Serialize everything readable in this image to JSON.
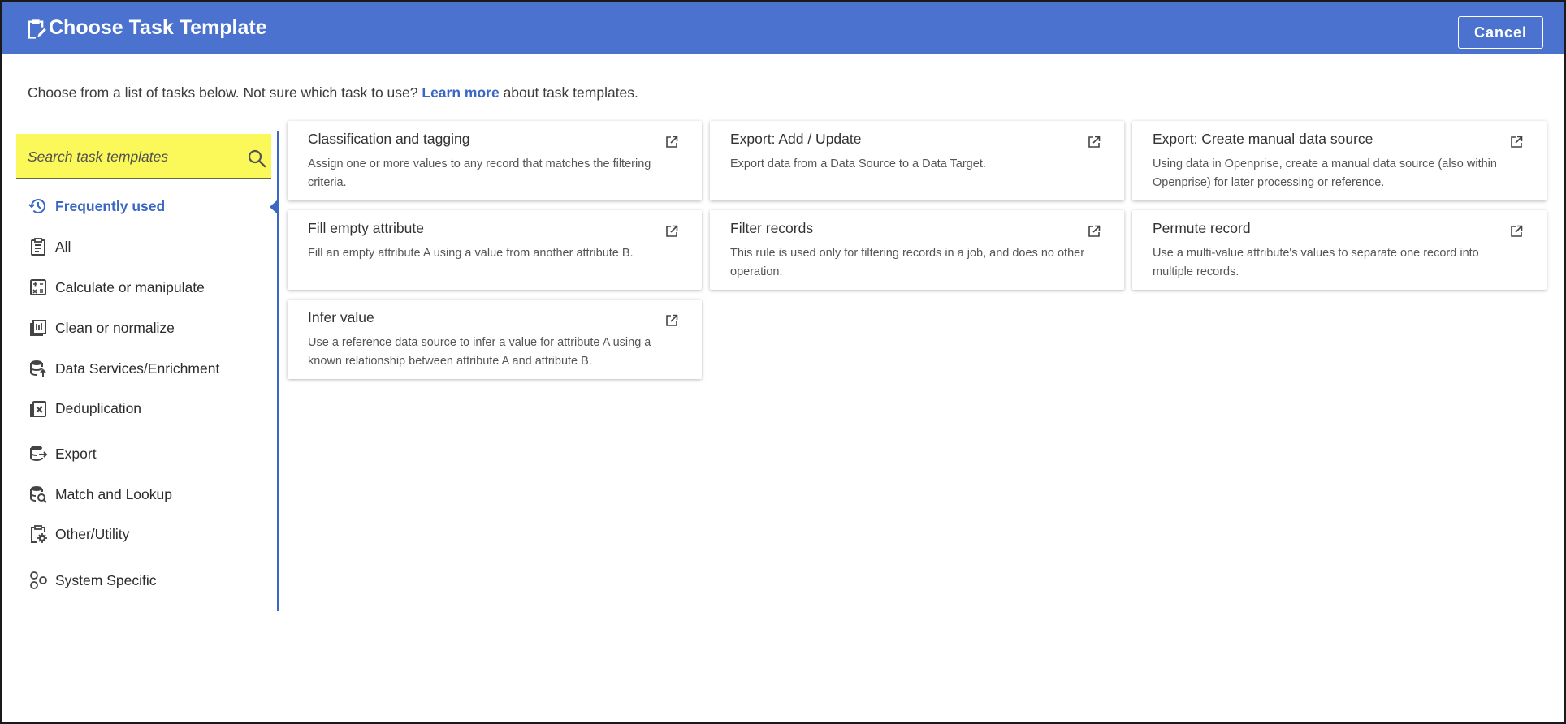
{
  "dialog": {
    "title": "Choose Task Template",
    "cancel_label": "Cancel",
    "header_color": "#4a72ce"
  },
  "intro": {
    "text_before": "Choose from a list of tasks below. Not sure which task to use?",
    "link_text": "Learn more",
    "text_after": "about task templates."
  },
  "search": {
    "placeholder": "Search task templates",
    "value": ""
  },
  "nav": {
    "items": [
      {
        "label": "Frequently used",
        "icon": "history-icon",
        "active": true
      },
      {
        "label": "All",
        "icon": "clipboard-list-icon"
      },
      {
        "label": "Calculate or manipulate",
        "icon": "calculator-icon"
      },
      {
        "label": "Clean or normalize",
        "icon": "list-broom-icon"
      },
      {
        "label": "Data Services/Enrichment",
        "icon": "database-upload-icon"
      },
      {
        "label": "Deduplication",
        "icon": "clipboard-remove-icon"
      },
      {
        "label": "Export",
        "icon": "database-export-icon"
      },
      {
        "label": "Match and Lookup",
        "icon": "database-search-icon"
      },
      {
        "label": "Other/Utility",
        "icon": "clipboard-gear-icon"
      },
      {
        "label": "System Specific",
        "icon": "shapes-icon"
      }
    ]
  },
  "cards": [
    {
      "title": "Classification and tagging",
      "desc": "Assign one or more values to any record that matches the filtering criteria."
    },
    {
      "title": "Export: Add / Update",
      "desc": "Export data from a Data Source to a Data Target."
    },
    {
      "title": "Export: Create manual data source",
      "desc": "Using data in Openprise, create a manual data source (also within Openprise) for later processing or reference."
    },
    {
      "title": "Fill empty attribute",
      "desc": "Fill an empty attribute A using a value from another attribute B."
    },
    {
      "title": "Filter records",
      "desc": "This rule is used only for filtering records in a job, and does no other operation."
    },
    {
      "title": "Permute record",
      "desc": "Use a multi-value attribute's values to separate one record into multiple records."
    },
    {
      "title": "Infer value",
      "desc": "Use a reference data source to infer a value for attribute A using a known relationship between attribute A and attribute B."
    }
  ]
}
